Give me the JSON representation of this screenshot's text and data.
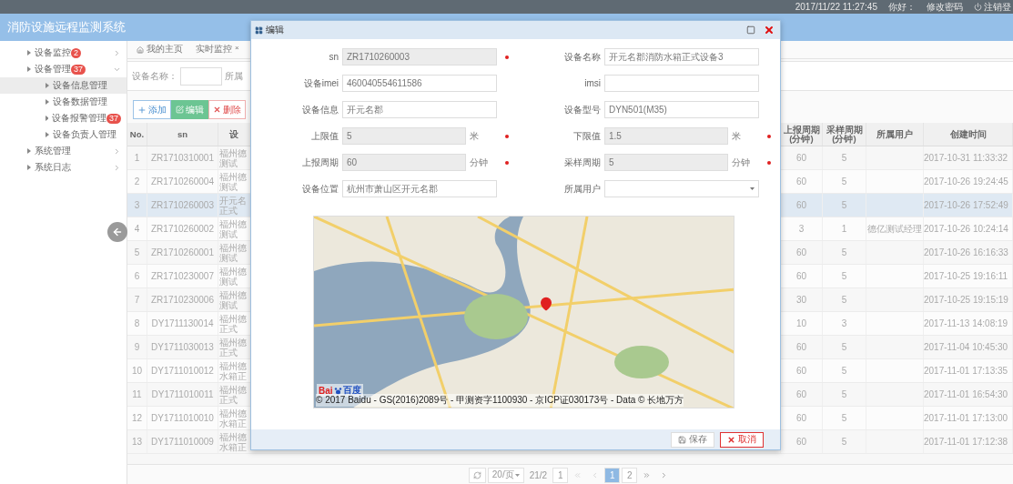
{
  "top_bar": {
    "datetime": "2017/11/22 11:27:45",
    "greeting": "你好：",
    "change_password": "修改密码",
    "logout": "注销登"
  },
  "app_title": "消防设施远程监测系统",
  "sidebar": {
    "items": [
      {
        "label": "设备监控",
        "badge": "2",
        "expanded": false
      },
      {
        "label": "设备管理",
        "badge": "37",
        "expanded": true,
        "children": [
          {
            "label": "设备信息管理",
            "selected": true
          },
          {
            "label": "设备数据管理",
            "selected": false
          },
          {
            "label": "设备报警管理",
            "badge": "37",
            "selected": false
          },
          {
            "label": "设备负责人管理",
            "selected": false
          }
        ]
      },
      {
        "label": "系统管理",
        "expanded": false
      },
      {
        "label": "系统日志",
        "expanded": false
      }
    ]
  },
  "tabs": [
    {
      "kind": "home",
      "label": "我的主页"
    },
    {
      "kind": "closable",
      "label": "实时监控",
      "close": "×"
    }
  ],
  "search": {
    "label": "设备名称：",
    "next_label": "所属"
  },
  "toolbar": [
    {
      "kind": "add",
      "label": "添加"
    },
    {
      "kind": "edit",
      "label": "编辑"
    },
    {
      "kind": "delete",
      "label": "删除"
    }
  ],
  "table": {
    "columns": [
      "No.",
      "sn",
      "设",
      "上报周期 (分钟)",
      "采样周期 (分钟)",
      "所属用户",
      "创建时间"
    ],
    "rows": [
      {
        "no": "1",
        "sn": "ZR1710310001",
        "column_3": [
          "福州德",
          "测试"
        ],
        "report_period": "60",
        "sample_period": "5",
        "created": "2017-10-31 11:33:32",
        "selected": false
      },
      {
        "no": "2",
        "sn": "ZR1710260004",
        "column_3": [
          "福州德",
          "测试"
        ],
        "report_period": "60",
        "sample_period": "5",
        "created": "2017-10-26 19:24:45",
        "selected": false
      },
      {
        "no": "3",
        "sn": "ZR1710260003",
        "column_3": [
          "开元名",
          "正式"
        ],
        "report_period": "60",
        "sample_period": "5",
        "created": "2017-10-26 17:52:49",
        "selected": true
      },
      {
        "no": "4",
        "sn": "ZR1710260002",
        "column_3": [
          "福州德",
          "测试"
        ],
        "report_period": "3",
        "sample_period": "1",
        "user": "德亿测试经理",
        "created": "2017-10-26 10:24:14",
        "selected": false
      },
      {
        "no": "5",
        "sn": "ZR1710260001",
        "column_3": [
          "福州德",
          "测试"
        ],
        "report_period": "60",
        "sample_period": "5",
        "created": "2017-10-26 16:16:33",
        "selected": false
      },
      {
        "no": "6",
        "sn": "ZR1710230007",
        "column_3": [
          "福州德",
          "测试"
        ],
        "report_period": "60",
        "sample_period": "5",
        "created": "2017-10-25 19:16:11",
        "selected": false
      },
      {
        "no": "7",
        "sn": "ZR1710230006",
        "column_3": [
          "福州德",
          "测试"
        ],
        "report_period": "30",
        "sample_period": "5",
        "created": "2017-10-25 19:15:19",
        "selected": false
      },
      {
        "no": "8",
        "sn": "DY1711130014",
        "column_3": [
          "福州德",
          "正式"
        ],
        "report_period": "10",
        "sample_period": "3",
        "created": "2017-11-13 14:08:19",
        "selected": false
      },
      {
        "no": "9",
        "sn": "DY1711030013",
        "column_3": [
          "福州德",
          "正式"
        ],
        "report_period": "60",
        "sample_period": "5",
        "created": "2017-11-04 10:45:30",
        "selected": false
      },
      {
        "no": "10",
        "sn": "DY1711010012",
        "column_3": [
          "福州德",
          "水箱正"
        ],
        "report_period": "60",
        "sample_period": "5",
        "created": "2017-11-01 17:13:35",
        "selected": false
      },
      {
        "no": "11",
        "sn": "DY1711010011",
        "column_3": [
          "福州德",
          "正式"
        ],
        "report_period": "60",
        "sample_period": "5",
        "created": "2017-11-01 16:54:30",
        "selected": false
      },
      {
        "no": "12",
        "sn": "DY1711010010",
        "column_3": [
          "福州德",
          "水箱正"
        ],
        "report_period": "60",
        "sample_period": "5",
        "created": "2017-11-01 17:13:00",
        "selected": false
      },
      {
        "no": "13",
        "sn": "DY1711010009",
        "column_3": [
          "福州德",
          "水箱正"
        ],
        "report_period": "60",
        "sample_period": "5",
        "created": "2017-11-01 17:12:38",
        "selected": false
      }
    ]
  },
  "pagination": {
    "page_size": "20/页",
    "range": "21/2",
    "page_input": "1",
    "pages": [
      {
        "label": "1",
        "selected": true
      },
      {
        "label": "2",
        "selected": false
      }
    ]
  },
  "dialog": {
    "title": "编辑",
    "fields": [
      {
        "kind": "text",
        "label": "sn",
        "value": "ZR1710260003",
        "disabled": true,
        "required": true
      },
      {
        "kind": "text",
        "label": "设备名称",
        "value": "开元名郡消防水箱正式设备3",
        "disabled": false,
        "required": false
      },
      {
        "kind": "text",
        "label": "设备imei",
        "value": "460040554611586",
        "disabled": false,
        "required": false
      },
      {
        "kind": "text",
        "label": "imsi",
        "disabled": false,
        "required": false
      },
      {
        "kind": "text",
        "label": "设备信息",
        "value": "开元名郡",
        "disabled": false,
        "required": false
      },
      {
        "kind": "text",
        "label": "设备型号",
        "value": "DYN501(M35)",
        "disabled": false,
        "required": false
      },
      {
        "kind": "text",
        "label": "上限值",
        "value": "5",
        "unit": "米",
        "disabled": true,
        "required": true
      },
      {
        "kind": "text",
        "label": "下限值",
        "value": "1.5",
        "unit": "米",
        "disabled": true,
        "required": true
      },
      {
        "kind": "text",
        "label": "上报周期",
        "value": "60",
        "unit": "分钟",
        "disabled": true,
        "required": true
      },
      {
        "kind": "text",
        "label": "采样周期",
        "value": "5",
        "unit": "分钟",
        "disabled": true,
        "required": true
      },
      {
        "kind": "text",
        "label": "设备位置",
        "value": "杭州市萧山区开元名郡",
        "disabled": false,
        "required": false
      },
      {
        "kind": "select",
        "label": "所属用户",
        "disabled": false,
        "required": false
      }
    ],
    "map": {
      "logo": [
        "Bai",
        "百度"
      ],
      "attribution": "© 2017 Baidu - GS(2016)2089号 - 甲测资字1100930 - 京ICP证030173号 - Data © 长地万方"
    },
    "buttons": [
      {
        "kind": "save",
        "label": "保存"
      },
      {
        "kind": "cancel",
        "label": "取消"
      }
    ]
  }
}
